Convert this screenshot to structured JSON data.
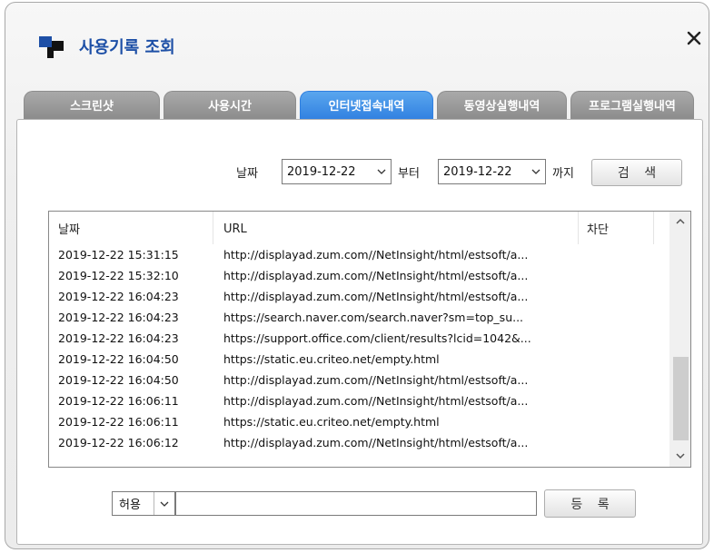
{
  "window": {
    "title": "사용기록 조회",
    "close_label": "✕"
  },
  "tabs": [
    {
      "label": "스크린샷",
      "active": false
    },
    {
      "label": "사용시간",
      "active": false
    },
    {
      "label": "인터넷접속내역",
      "active": true
    },
    {
      "label": "동영상실행내역",
      "active": false
    },
    {
      "label": "프로그램실행내역",
      "active": false
    }
  ],
  "search": {
    "date_label": "날짜",
    "from_date": "2019-12-22",
    "from_suffix": "부터",
    "to_date": "2019-12-22",
    "to_suffix": "까지",
    "search_button": "검 색"
  },
  "table": {
    "columns": [
      "날짜",
      "URL",
      "차단"
    ],
    "rows": [
      {
        "date": "2019-12-22 15:31:15",
        "url": "http://displayad.zum.com//NetInsight/html/estsoft/a...",
        "block": ""
      },
      {
        "date": "2019-12-22 15:32:10",
        "url": "http://displayad.zum.com//NetInsight/html/estsoft/a...",
        "block": ""
      },
      {
        "date": "2019-12-22 16:04:23",
        "url": "http://displayad.zum.com//NetInsight/html/estsoft/a...",
        "block": ""
      },
      {
        "date": "2019-12-22 16:04:23",
        "url": "https://search.naver.com/search.naver?sm=top_su...",
        "block": ""
      },
      {
        "date": "2019-12-22 16:04:23",
        "url": "https://support.office.com/client/results?lcid=1042&...",
        "block": ""
      },
      {
        "date": "2019-12-22 16:04:50",
        "url": "https://static.eu.criteo.net/empty.html",
        "block": ""
      },
      {
        "date": "2019-12-22 16:04:50",
        "url": "http://displayad.zum.com//NetInsight/html/estsoft/a...",
        "block": ""
      },
      {
        "date": "2019-12-22 16:06:11",
        "url": "http://displayad.zum.com//NetInsight/html/estsoft/a...",
        "block": ""
      },
      {
        "date": "2019-12-22 16:06:11",
        "url": "https://static.eu.criteo.net/empty.html",
        "block": ""
      },
      {
        "date": "2019-12-22 16:06:12",
        "url": "http://displayad.zum.com//NetInsight/html/estsoft/a...",
        "block": ""
      }
    ]
  },
  "register": {
    "policy_value": "허용",
    "input_value": "",
    "register_button": "등 록"
  },
  "colors": {
    "title": "#1d4fa6",
    "active_tab": "#3a8ae6",
    "inactive_tab": "#999999"
  }
}
